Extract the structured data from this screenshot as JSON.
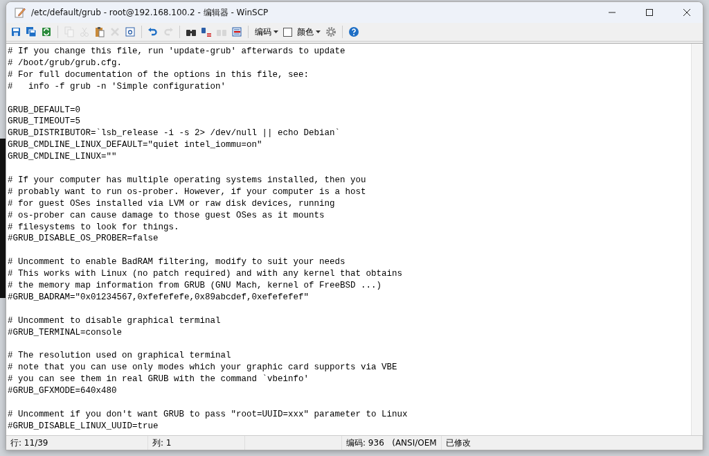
{
  "window": {
    "title": "/etc/default/grub - root@192.168.100.2 - 编辑器 - WinSCP"
  },
  "toolbar": [
    {
      "kind": "icon",
      "disabled": false
    },
    {
      "kind": "icon",
      "disabled": false
    },
    {
      "kind": "icon",
      "disabled": false
    },
    {
      "kind": "separator"
    },
    {
      "kind": "icon",
      "disabled": true
    },
    {
      "kind": "icon",
      "disabled": true
    },
    {
      "kind": "icon",
      "disabled": false
    },
    {
      "kind": "icon",
      "disabled": true
    },
    {
      "kind": "icon",
      "disabled": false
    },
    {
      "kind": "separator"
    },
    {
      "kind": "icon",
      "disabled": false
    },
    {
      "kind": "icon",
      "disabled": true
    },
    {
      "kind": "separator"
    },
    {
      "kind": "icon",
      "disabled": false
    },
    {
      "kind": "icon",
      "disabled": false
    },
    {
      "kind": "icon",
      "disabled": true
    },
    {
      "kind": "icon",
      "disabled": false
    },
    {
      "kind": "separator"
    },
    {
      "kind": "dropdown",
      "label": "编码"
    },
    {
      "kind": "checkbox",
      "checked": false
    },
    {
      "kind": "dropdown",
      "label": "颜色"
    },
    {
      "kind": "icon",
      "disabled": false
    },
    {
      "kind": "separator"
    },
    {
      "kind": "icon",
      "disabled": false
    }
  ],
  "editor": {
    "blocks": [
      [
        "# If you change this file, run 'update-grub' afterwards to update",
        "# /boot/grub/grub.cfg.",
        "# For full documentation of the options in this file, see:",
        "#   info -f grub -n 'Simple configuration'"
      ],
      [
        "GRUB_DEFAULT=0",
        "GRUB_TIMEOUT=5",
        "GRUB_DISTRIBUTOR=`lsb_release -i -s 2> /dev/null || echo Debian`",
        "GRUB_CMDLINE_LINUX_DEFAULT=\"quiet intel_iommu=on\"",
        "GRUB_CMDLINE_LINUX=\"\""
      ],
      [
        "# If your computer has multiple operating systems installed, then you",
        "# probably want to run os-prober. However, if your computer is a host",
        "# for guest OSes installed via LVM or raw disk devices, running",
        "# os-prober can cause damage to those guest OSes as it mounts",
        "# filesystems to look for things.",
        "#GRUB_DISABLE_OS_PROBER=false"
      ],
      [
        "# Uncomment to enable BadRAM filtering, modify to suit your needs",
        "# This works with Linux (no patch required) and with any kernel that obtains",
        "# the memory map information from GRUB (GNU Mach, kernel of FreeBSD ...)",
        "#GRUB_BADRAM=\"0x01234567,0xfefefefe,0x89abcdef,0xefefefef\""
      ],
      [
        "# Uncomment to disable graphical terminal",
        "#GRUB_TERMINAL=console"
      ],
      [
        "# The resolution used on graphical terminal",
        "# note that you can use only modes which your graphic card supports via VBE",
        "# you can see them in real GRUB with the command `vbeinfo'",
        "#GRUB_GFXMODE=640x480"
      ],
      [
        "# Uncomment if you don't want GRUB to pass \"root=UUID=xxx\" parameter to Linux",
        "#GRUB_DISABLE_LINUX_UUID=true"
      ]
    ]
  },
  "status_bar": {
    "line": "行: 11/39",
    "column": "列: 1",
    "encoding": "编码: 936   (ANSI/OEM",
    "modified": "已修改"
  }
}
